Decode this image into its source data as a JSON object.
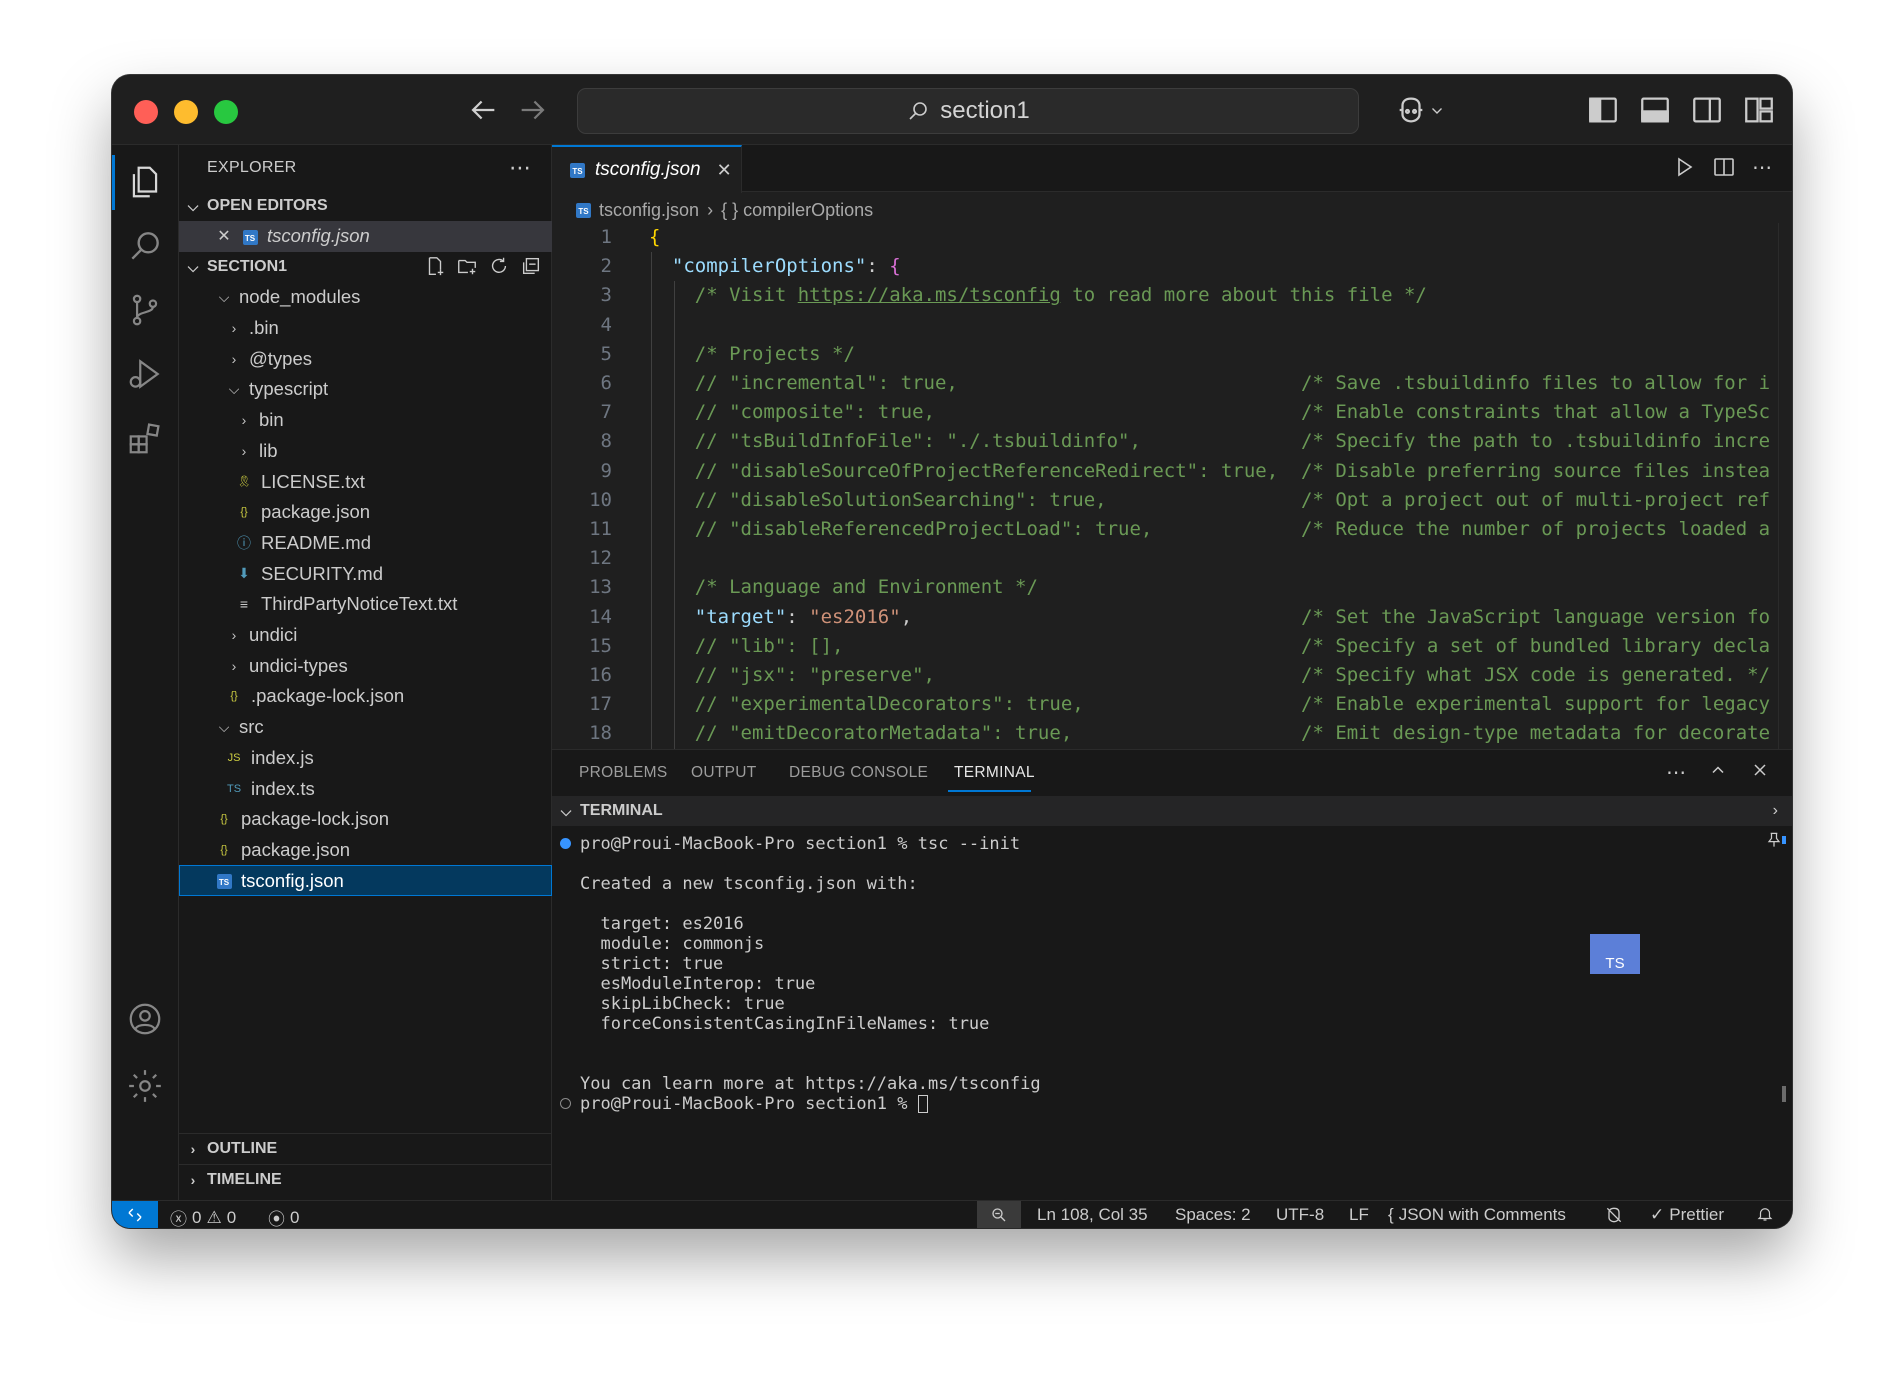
{
  "titlebar": {
    "search_text": "section1"
  },
  "sidebar": {
    "header": "EXPLORER",
    "open_editors_label": "OPEN EDITORS",
    "open_editor_file": "tsconfig.json",
    "section_label": "SECTION1",
    "tree": [
      {
        "label": "node_modules",
        "type": "folder-open"
      },
      {
        "label": ".bin",
        "type": "folder"
      },
      {
        "label": "@types",
        "type": "folder"
      },
      {
        "label": "typescript",
        "type": "folder-open"
      },
      {
        "label": "bin",
        "type": "folder"
      },
      {
        "label": "lib",
        "type": "folder"
      },
      {
        "label": "LICENSE.txt",
        "type": "license"
      },
      {
        "label": "package.json",
        "type": "json"
      },
      {
        "label": "README.md",
        "type": "info"
      },
      {
        "label": "SECURITY.md",
        "type": "markdown"
      },
      {
        "label": "ThirdPartyNoticeText.txt",
        "type": "text"
      },
      {
        "label": "undici",
        "type": "folder"
      },
      {
        "label": "undici-types",
        "type": "folder"
      },
      {
        "label": ".package-lock.json",
        "type": "json"
      },
      {
        "label": "src",
        "type": "folder-open"
      },
      {
        "label": "index.js",
        "type": "js"
      },
      {
        "label": "index.ts",
        "type": "ts"
      },
      {
        "label": "package-lock.json",
        "type": "json"
      },
      {
        "label": "package.json",
        "type": "json"
      },
      {
        "label": "tsconfig.json",
        "type": "ts-config"
      }
    ],
    "outline_label": "OUTLINE",
    "timeline_label": "TIMELINE"
  },
  "editor": {
    "tab_label": "tsconfig.json",
    "breadcrumb_file": "tsconfig.json",
    "breadcrumb_symbol": "{ } compilerOptions",
    "line_numbers": [
      "1",
      "2",
      "3",
      "4",
      "5",
      "6",
      "7",
      "8",
      "9",
      "10",
      "11",
      "12",
      "13",
      "14",
      "15",
      "16",
      "17",
      "18"
    ],
    "lines": [
      "{",
      "  \"compilerOptions\": {",
      "    /* Visit https://aka.ms/tsconfig to read more about this file */",
      "",
      "    /* Projects */",
      "    // \"incremental\": true,                              /* Save .tsbuildinfo files to allow for i",
      "    // \"composite\": true,                                /* Enable constraints that allow a TypeSc",
      "    // \"tsBuildInfoFile\": \"./.tsbuildinfo\",              /* Specify the path to .tsbuildinfo incre",
      "    // \"disableSourceOfProjectReferenceRedirect\": true,  /* Disable preferring source files instea",
      "    // \"disableSolutionSearching\": true,                 /* Opt a project out of multi-project ref",
      "    // \"disableReferencedProjectLoad\": true,             /* Reduce the number of projects loaded a",
      "",
      "    /* Language and Environment */",
      "    \"target\": \"es2016\",                                  /* Set the JavaScript language version fo",
      "    // \"lib\": [],                                        /* Specify a set of bundled library decla",
      "    // \"jsx\": \"preserve\",                                /* Specify what JSX code is generated. */",
      "    // \"experimentalDecorators\": true,                   /* Enable experimental support for legacy",
      "    // \"emitDecoratorMetadata\": true,                    /* Emit design-type metadata for decorate"
    ]
  },
  "panel": {
    "tabs": [
      "PROBLEMS",
      "OUTPUT",
      "DEBUG CONSOLE",
      "TERMINAL"
    ],
    "terminal_header": "TERMINAL",
    "terminal_lines": [
      "pro@Proui-MacBook-Pro section1 % tsc --init",
      "Created a new tsconfig.json with:",
      "  target: es2016",
      "  module: commonjs",
      "  strict: true",
      "  esModuleInterop: true",
      "  skipLibCheck: true",
      "  forceConsistentCasingInFileNames: true",
      "You can learn more at https://aka.ms/tsconfig",
      "pro@Proui-MacBook-Pro section1 % "
    ],
    "ts_badge": "TS"
  },
  "statusbar": {
    "errors": "0",
    "warnings": "0",
    "ports": "0",
    "position": "Ln 108, Col 35",
    "spaces": "Spaces: 2",
    "encoding": "UTF-8",
    "eol": "LF",
    "language": "JSON with Comments",
    "formatter": "Prettier"
  },
  "colors": {
    "accent": "#0078d4",
    "ts_blue": "#3178c6",
    "json_yellow": "#cbcb41"
  }
}
